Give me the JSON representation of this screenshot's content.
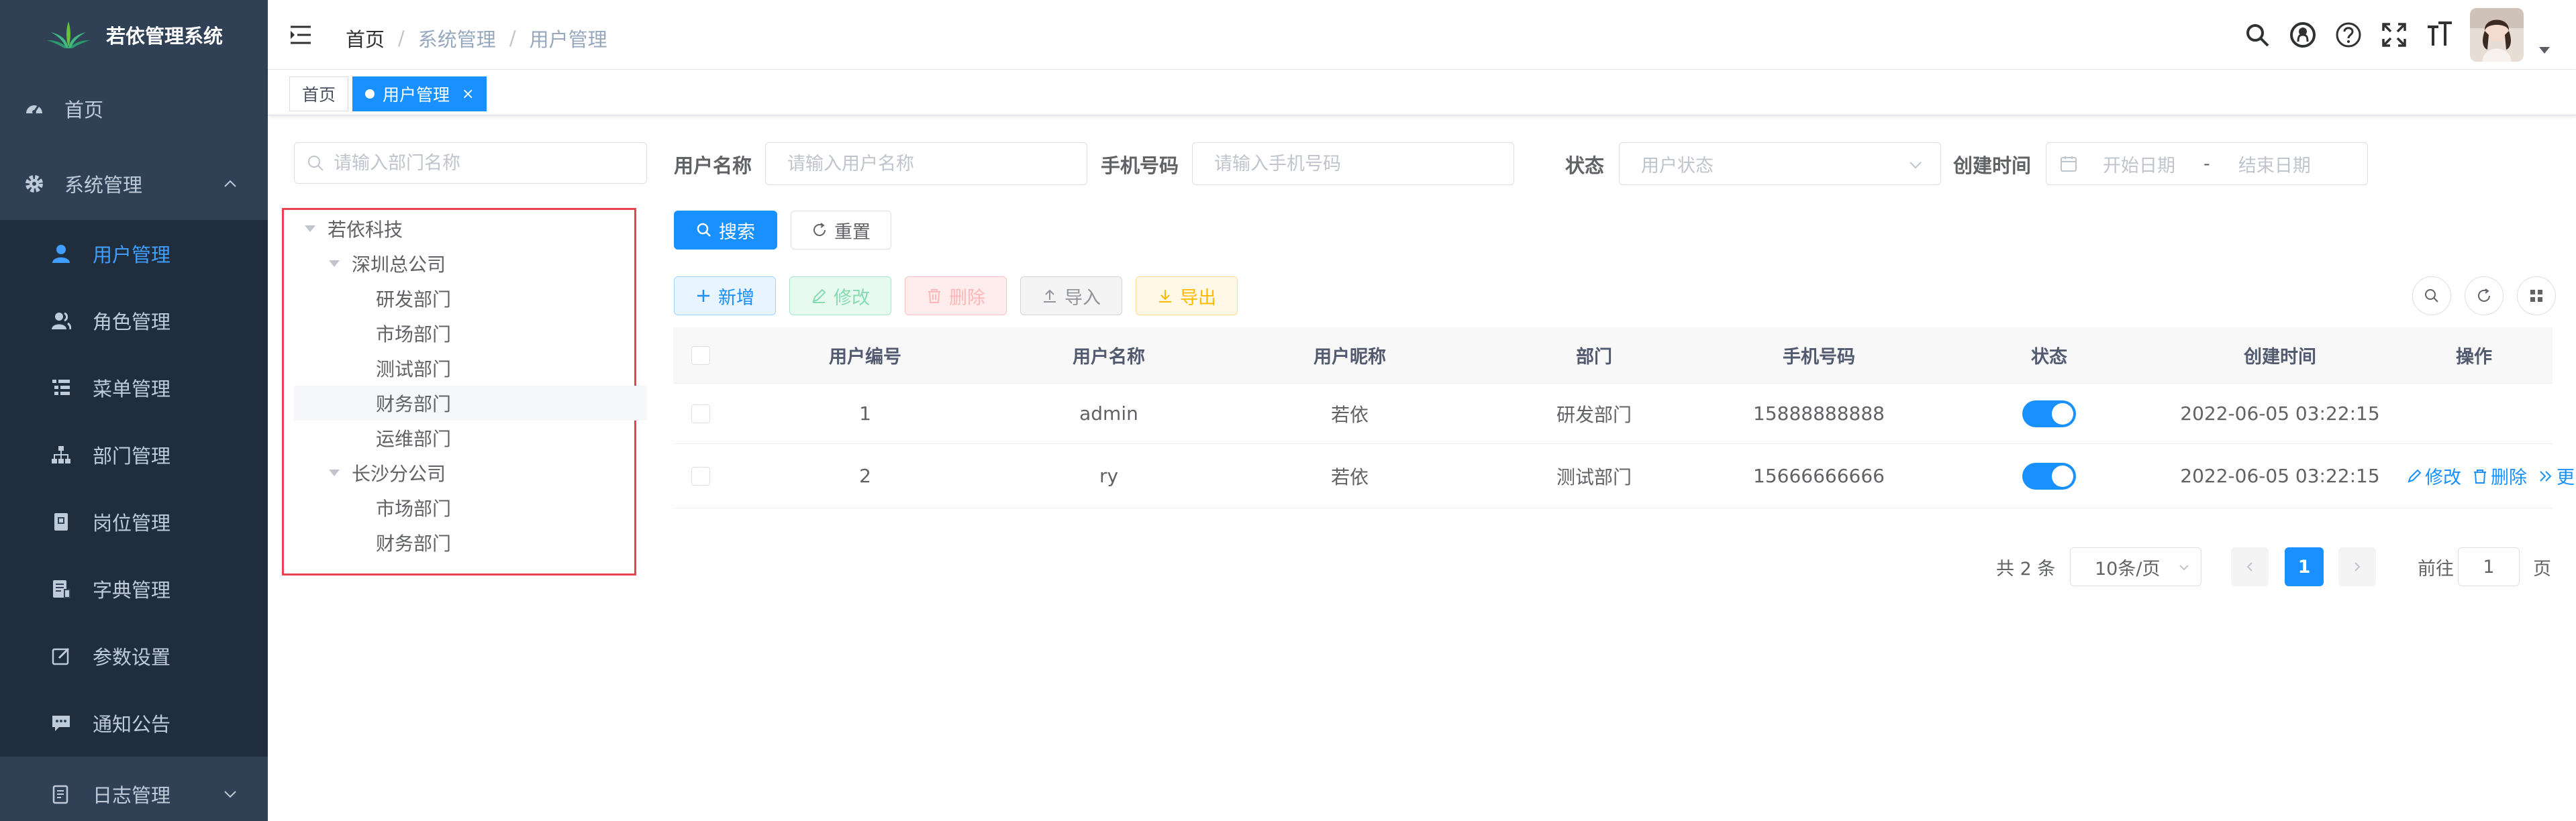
{
  "app": {
    "title": "若依管理系统"
  },
  "sidebar": {
    "items": [
      {
        "label": "首页",
        "icon": "dashboard-icon"
      },
      {
        "label": "系统管理",
        "icon": "gear-icon"
      },
      {
        "label": "用户管理",
        "icon": "user-icon"
      },
      {
        "label": "角色管理",
        "icon": "peoples-icon"
      },
      {
        "label": "菜单管理",
        "icon": "tree-table-icon"
      },
      {
        "label": "部门管理",
        "icon": "org-tree-icon"
      },
      {
        "label": "岗位管理",
        "icon": "post-icon"
      },
      {
        "label": "字典管理",
        "icon": "dict-icon"
      },
      {
        "label": "参数设置",
        "icon": "edit-icon"
      },
      {
        "label": "通知公告",
        "icon": "message-icon"
      },
      {
        "label": "日志管理",
        "icon": "log-icon"
      }
    ],
    "colors": {
      "bg": "#304156",
      "sub_bg": "#1f2d3d",
      "active": "#409eff",
      "text": "#bfcbd9"
    }
  },
  "navbar": {
    "breadcrumb": [
      "首页",
      "系统管理",
      "用户管理"
    ],
    "breadcrumb_sep": "/",
    "icons": [
      "search-icon",
      "github-icon",
      "help-icon",
      "fullscreen-icon",
      "font-size-icon",
      "avatar"
    ]
  },
  "tags": {
    "home": "首页",
    "active": "用户管理",
    "close": "×"
  },
  "tree": {
    "search_placeholder": "请输入部门名称",
    "nodes": {
      "root": "若依科技",
      "shenzhen": "深圳总公司",
      "yanfa": "研发部门",
      "shichang1": "市场部门",
      "ceshi": "测试部门",
      "caiwu1": "财务部门",
      "yunwei": "运维部门",
      "changsha": "长沙分公司",
      "shichang2": "市场部门",
      "caiwu2": "财务部门"
    }
  },
  "search_form": {
    "username_label": "用户名称",
    "username_placeholder": "请输入用户名称",
    "phone_label": "手机号码",
    "phone_placeholder": "请输入手机号码",
    "status_label": "状态",
    "status_placeholder": "用户状态",
    "created_label": "创建时间",
    "start_placeholder": "开始日期",
    "range_sep": "-",
    "end_placeholder": "结束日期",
    "search_button": "搜索",
    "reset_button": "重置"
  },
  "toolbar": {
    "add": "新增",
    "edit": "修改",
    "delete": "删除",
    "import": "导入",
    "export": "导出"
  },
  "table": {
    "columns": [
      "用户编号",
      "用户名称",
      "用户昵称",
      "部门",
      "手机号码",
      "状态",
      "创建时间",
      "操作"
    ],
    "rows": [
      {
        "id": "1",
        "username": "admin",
        "nickname": "若依",
        "dept": "研发部门",
        "phone": "15888888888",
        "enabled": true,
        "created": "2022-06-05 03:22:15"
      },
      {
        "id": "2",
        "username": "ry",
        "nickname": "若依",
        "dept": "测试部门",
        "phone": "15666666666",
        "enabled": true,
        "created": "2022-06-05 03:22:15"
      }
    ],
    "row_actions": {
      "edit": "修改",
      "delete": "删除",
      "more": "更多"
    }
  },
  "pagination": {
    "total_text": "共 2 条",
    "page_size": "10条/页",
    "current_page": "1",
    "goto_label": "前往",
    "goto_value": "1",
    "page_suffix": "页"
  },
  "colors": {
    "primary": "#1890ff",
    "tree_highlight_border": "#e8434f"
  }
}
